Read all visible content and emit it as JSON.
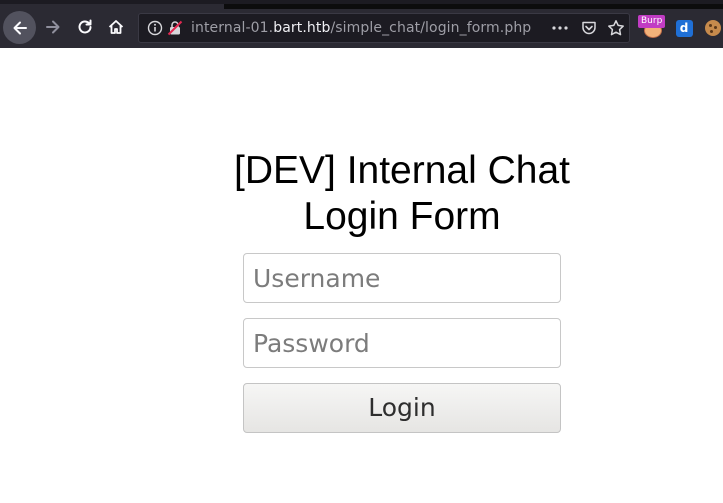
{
  "browser": {
    "url_prefix": "internal-01.",
    "url_domain": "bart.htb",
    "url_path": "/simple_chat/login_form.php",
    "icons": {
      "back": "back-arrow-icon",
      "forward": "forward-arrow-icon",
      "reload": "reload-icon",
      "home": "home-icon",
      "info": "info-icon",
      "insecure": "insecure-lock-icon",
      "page_actions": "more-icon",
      "pocket": "pocket-icon",
      "bookmark": "star-icon"
    },
    "extensions": {
      "burp_label": "Burp",
      "d_label": "d"
    }
  },
  "page": {
    "title_line1": "[DEV] Internal Chat",
    "title_line2": "Login Form",
    "username_placeholder": "Username",
    "password_placeholder": "Password",
    "login_label": "Login"
  },
  "colors": {
    "chrome_bg": "#2b2a33",
    "urlbar_bg": "#1c1b22",
    "burp_badge": "#c13cc4",
    "page_bg": "#ffffff"
  }
}
